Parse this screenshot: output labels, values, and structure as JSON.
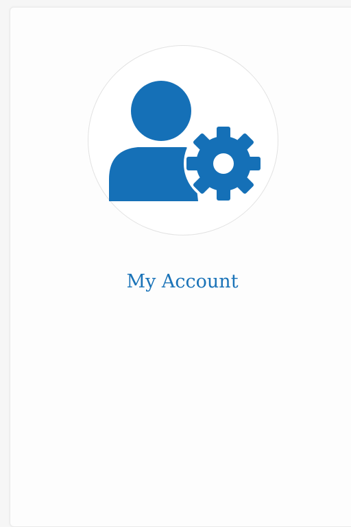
{
  "account_card": {
    "link_label": "My Account",
    "icon": "user-settings-icon",
    "accent_color": "#1570b7"
  }
}
